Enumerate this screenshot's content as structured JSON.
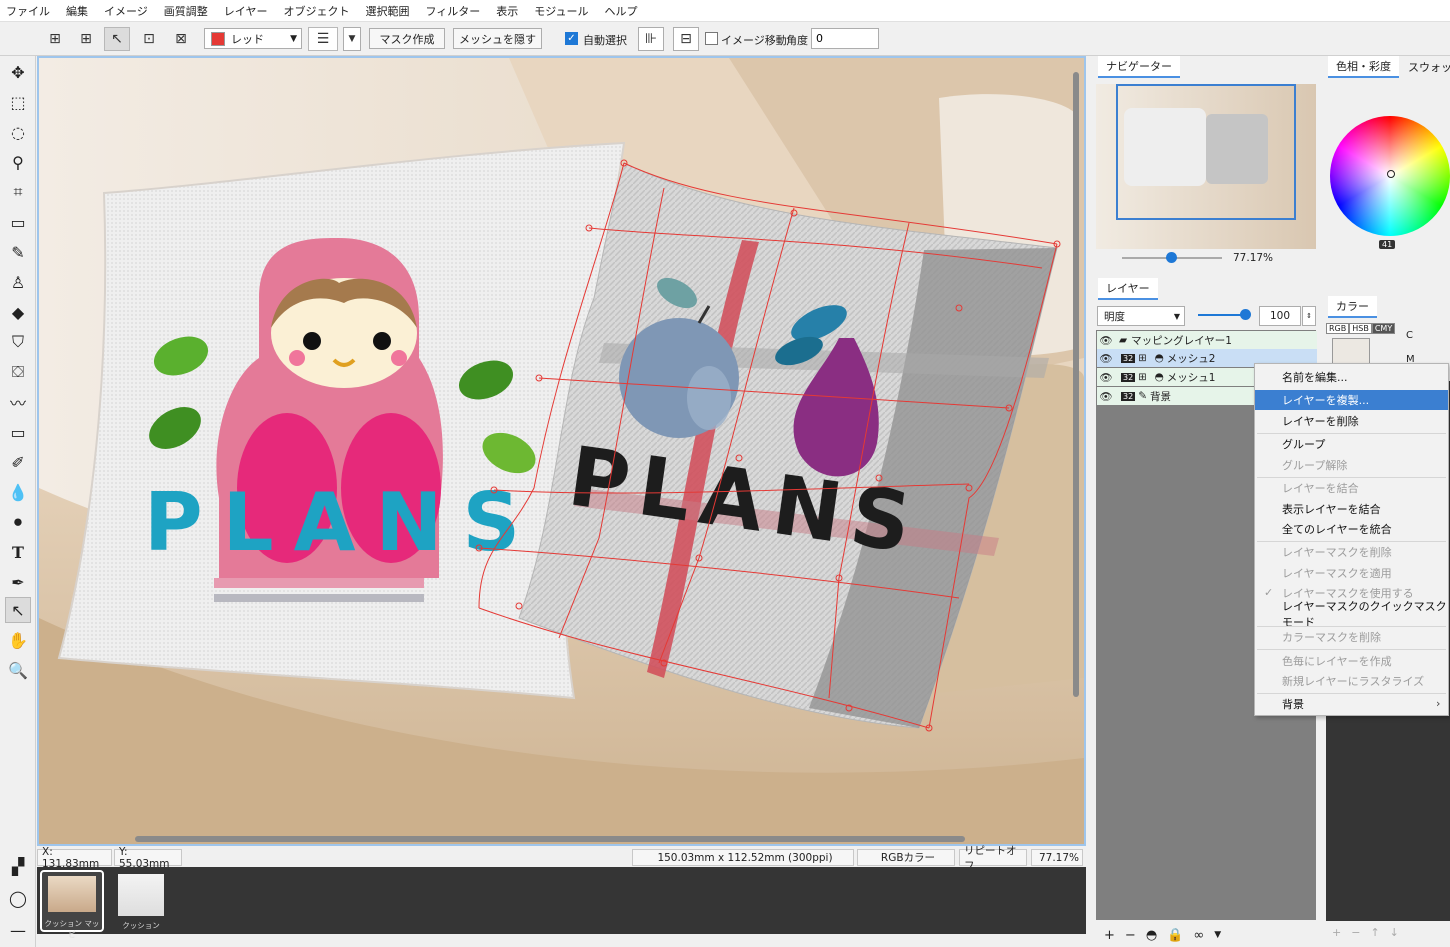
{
  "menubar": [
    "ファイル",
    "編集",
    "イメージ",
    "画質調整",
    "レイヤー",
    "オブジェクト",
    "選択範囲",
    "フィルター",
    "表示",
    "モジュール",
    "ヘルプ"
  ],
  "toolbar": {
    "color_name": "レッド",
    "color_swatch": "#e53935",
    "mask_button": "マスク作成",
    "hide_mesh_button": "メッシュを隠す",
    "auto_select_label": "自動選択",
    "auto_select_checked": true,
    "image_move_label": "イメージ移動",
    "image_move_checked": false,
    "angle_label": "角度",
    "angle_value": "0"
  },
  "status": {
    "x": "X:  131.83mm",
    "y": "Y:   55.03mm",
    "size": "150.03mm x 112.52mm (300ppi)",
    "colormode": "RGBカラー",
    "repeat": "リピートオフ",
    "zoom": "77.17%"
  },
  "filmstrip": [
    {
      "label": "クッション マッピ"
    },
    {
      "label": "クッション"
    }
  ],
  "navigator": {
    "tab": "ナビゲーター",
    "zoom": "77.17%"
  },
  "layers": {
    "tab": "レイヤー",
    "blend_mode": "明度",
    "opacity": "100",
    "items": [
      {
        "name": "マッピングレイヤー1",
        "badge": ""
      },
      {
        "name": "メッシュ2",
        "badge": "32"
      },
      {
        "name": "メッシュ1",
        "badge": "32"
      },
      {
        "name": "背景",
        "badge": "32"
      }
    ]
  },
  "color_panel": {
    "tab1": "色相・彩度",
    "tab2": "スウォッチ",
    "value_badge": "41",
    "color_tab": "カラー",
    "mode_tabs": [
      "RGB",
      "HSB",
      "CMY"
    ],
    "c_label": "C",
    "m_label": "M"
  },
  "context_menu": {
    "items": [
      {
        "label": "名前を編集...",
        "enabled": true
      },
      {
        "label": "レイヤーを複製...",
        "enabled": true,
        "highlighted": true
      },
      {
        "label": "レイヤーを削除",
        "enabled": true
      },
      {
        "label": "グループ",
        "enabled": true
      },
      {
        "label": "グループ解除",
        "enabled": false
      },
      {
        "label": "レイヤーを結合",
        "enabled": false
      },
      {
        "label": "表示レイヤーを結合",
        "enabled": true
      },
      {
        "label": "全てのレイヤーを統合",
        "enabled": true
      },
      {
        "label": "レイヤーマスクを削除",
        "enabled": false
      },
      {
        "label": "レイヤーマスクを適用",
        "enabled": false
      },
      {
        "label": "レイヤーマスクを使用する",
        "enabled": false,
        "checked": true
      },
      {
        "label": "レイヤーマスクのクイックマスクモード",
        "enabled": true
      },
      {
        "label": "カラーマスクを削除",
        "enabled": false
      },
      {
        "label": "色毎にレイヤーを作成",
        "enabled": false
      },
      {
        "label": "新規レイヤーにラスタライズ",
        "enabled": false
      },
      {
        "label": "背景",
        "enabled": true,
        "submenu": true
      }
    ]
  },
  "artwork": {
    "pillow_text": "PLANS"
  }
}
